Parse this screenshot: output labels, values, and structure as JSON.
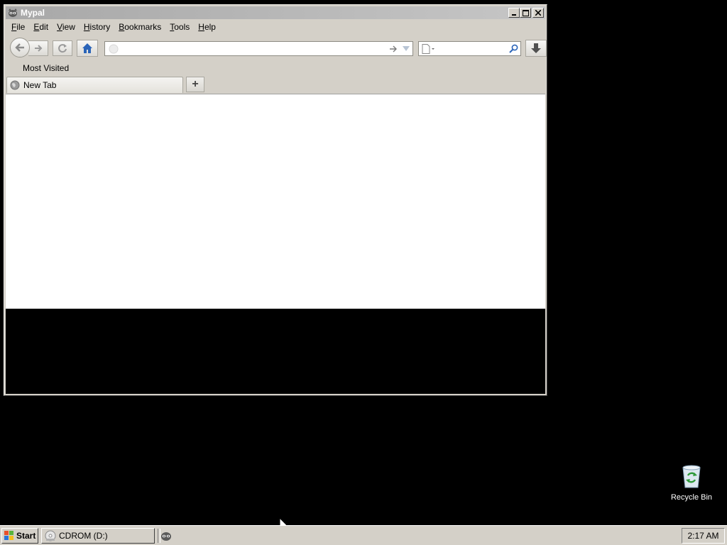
{
  "window": {
    "title": "Mypal",
    "menus": [
      {
        "label": "File",
        "accel": "F",
        "rest": "ile"
      },
      {
        "label": "Edit",
        "accel": "E",
        "rest": "dit"
      },
      {
        "label": "View",
        "accel": "V",
        "rest": "iew"
      },
      {
        "label": "History",
        "accel": "H",
        "rest": "istory"
      },
      {
        "label": "Bookmarks",
        "accel": "B",
        "rest": "ookmarks"
      },
      {
        "label": "Tools",
        "accel": "T",
        "rest": "ools"
      },
      {
        "label": "Help",
        "accel": "H",
        "rest": "elp"
      }
    ],
    "url_value": "",
    "search_value": "",
    "bookmarks_toolbar": {
      "item": "Most Visited"
    },
    "tabs": [
      {
        "label": "New Tab"
      }
    ],
    "new_tab_symbol": "+"
  },
  "desktop": {
    "icons": [
      {
        "label": "Recycle Bin",
        "icon": "recycle-bin-icon"
      }
    ]
  },
  "taskbar": {
    "start_label": "Start",
    "tasks": [
      {
        "label": "CDROM (D:)",
        "icon": "cdrom-icon"
      }
    ],
    "clock": "2:17 AM"
  },
  "colors": {
    "window_face": "#d4d0c8",
    "titlebar_inactive": "#a8a8a8",
    "desktop": "#000000",
    "home_icon": "#2a64b8"
  }
}
